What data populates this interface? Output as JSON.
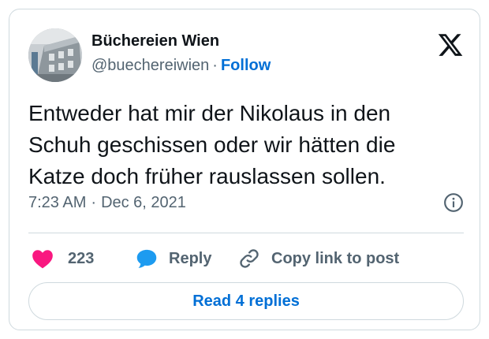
{
  "author": {
    "display_name": "Büchereien Wien",
    "handle": "@buechereiwien",
    "separator": "·",
    "follow_label": "Follow",
    "avatar_icon": "building-photo-avatar"
  },
  "brand": {
    "logo_icon": "x-logo-icon"
  },
  "tweet": {
    "text": "Entweder hat mir der Nikolaus in den Schuh geschissen oder wir hätten die Katze doch früher rauslassen sollen.",
    "time": "7:23 AM",
    "date_separator": "·",
    "date": "Dec 6, 2021",
    "info_icon": "info-icon"
  },
  "actions": {
    "like_count": "223",
    "reply_label": "Reply",
    "copy_label": "Copy link to post",
    "like_icon": "heart-icon",
    "reply_icon": "speech-bubble-icon",
    "copy_icon": "link-icon"
  },
  "footer": {
    "read_replies_label": "Read 4 replies"
  },
  "colors": {
    "text_primary": "#0f1419",
    "text_secondary": "#536471",
    "link_blue": "#006fd6",
    "heart_pink": "#f91880",
    "reply_blue": "#1d9bf0",
    "border": "#cfd9de"
  }
}
